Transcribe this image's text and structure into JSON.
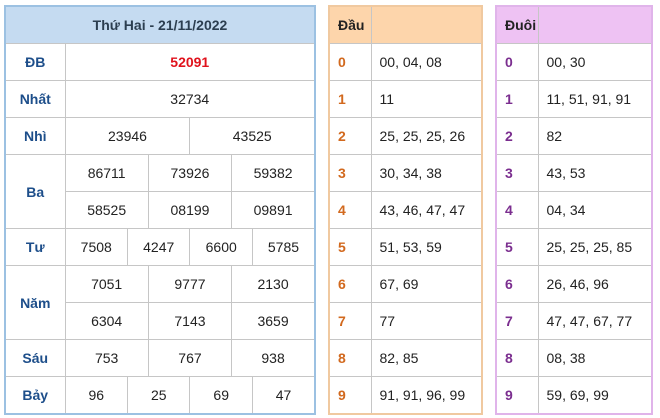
{
  "results": {
    "title": "Thứ Hai - 21/11/2022",
    "db": {
      "label": "ĐB",
      "values": [
        "52091"
      ]
    },
    "nhat": {
      "label": "Nhất",
      "values": [
        "32734"
      ]
    },
    "nhi": {
      "label": "Nhì",
      "values": [
        "23946",
        "43525"
      ]
    },
    "ba": {
      "label": "Ba",
      "row1": [
        "86711",
        "73926",
        "59382"
      ],
      "row2": [
        "58525",
        "08199",
        "09891"
      ]
    },
    "tu": {
      "label": "Tư",
      "values": [
        "7508",
        "4247",
        "6600",
        "5785"
      ]
    },
    "nam": {
      "label": "Năm",
      "row1": [
        "7051",
        "9777",
        "2130"
      ],
      "row2": [
        "6304",
        "7143",
        "3659"
      ]
    },
    "sau": {
      "label": "Sáu",
      "values": [
        "753",
        "767",
        "938"
      ]
    },
    "bay": {
      "label": "Bảy",
      "values": [
        "96",
        "25",
        "69",
        "47"
      ]
    }
  },
  "dau": {
    "header": "Đầu",
    "rows": [
      {
        "key": "0",
        "value": "00, 04, 08"
      },
      {
        "key": "1",
        "value": "11"
      },
      {
        "key": "2",
        "value": "25, 25, 25, 26"
      },
      {
        "key": "3",
        "value": "30, 34, 38"
      },
      {
        "key": "4",
        "value": "43, 46, 47, 47"
      },
      {
        "key": "5",
        "value": "51, 53, 59"
      },
      {
        "key": "6",
        "value": "67, 69"
      },
      {
        "key": "7",
        "value": "77"
      },
      {
        "key": "8",
        "value": "82, 85"
      },
      {
        "key": "9",
        "value": "91, 91, 96, 99"
      }
    ]
  },
  "duoi": {
    "header": "Đuôi",
    "rows": [
      {
        "key": "0",
        "value": "00, 30"
      },
      {
        "key": "1",
        "value": "11, 51, 91, 91"
      },
      {
        "key": "2",
        "value": "82"
      },
      {
        "key": "3",
        "value": "43, 53"
      },
      {
        "key": "4",
        "value": "04, 34"
      },
      {
        "key": "5",
        "value": "25, 25, 25, 85"
      },
      {
        "key": "6",
        "value": "26, 46, 96"
      },
      {
        "key": "7",
        "value": "47, 47, 67, 77"
      },
      {
        "key": "8",
        "value": "08, 38"
      },
      {
        "key": "9",
        "value": "59, 69, 99"
      }
    ]
  },
  "colors": {
    "db_value": "#e0121c",
    "results_header": "#c5dbf1",
    "dau_header": "#fdd5ab",
    "duoi_header": "#eec2f3"
  }
}
